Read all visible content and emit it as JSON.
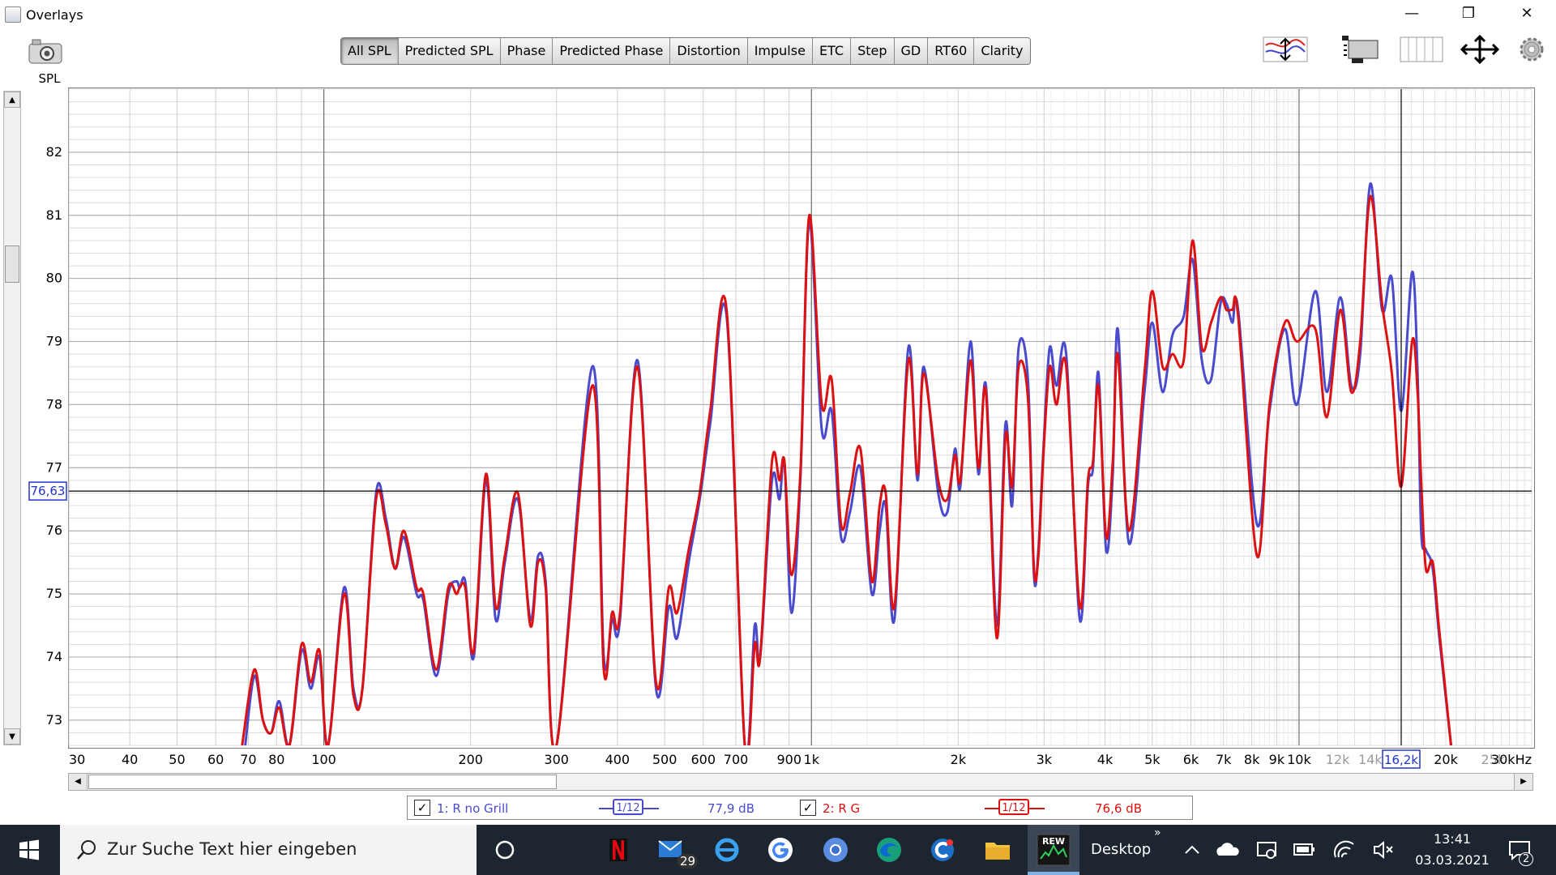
{
  "window": {
    "title": "Overlays",
    "min_glyph": "—",
    "max_glyph": "❐",
    "close_glyph": "✕"
  },
  "left_panel": {
    "label": "SPL"
  },
  "tabs": [
    {
      "label": "All SPL",
      "active": true
    },
    {
      "label": "Predicted SPL"
    },
    {
      "label": "Phase"
    },
    {
      "label": "Predicted Phase"
    },
    {
      "label": "Distortion"
    },
    {
      "label": "Impulse"
    },
    {
      "label": "ETC"
    },
    {
      "label": "Step"
    },
    {
      "label": "GD"
    },
    {
      "label": "RT60"
    },
    {
      "label": "Clarity"
    }
  ],
  "chart_data": {
    "type": "line",
    "x_scale": "log",
    "xlim": [
      30,
      30000
    ],
    "ylim": [
      72.6,
      83.0
    ],
    "grid": true,
    "y_ticks": [
      73,
      74,
      75,
      76,
      77,
      78,
      79,
      80,
      81,
      82
    ],
    "x_ticks": [
      {
        "v": 30,
        "l": "30"
      },
      {
        "v": 40,
        "l": "40"
      },
      {
        "v": 50,
        "l": "50"
      },
      {
        "v": 60,
        "l": "60"
      },
      {
        "v": 70,
        "l": "70"
      },
      {
        "v": 80,
        "l": "80"
      },
      {
        "v": 100,
        "l": "100"
      },
      {
        "v": 200,
        "l": "200"
      },
      {
        "v": 300,
        "l": "300"
      },
      {
        "v": 400,
        "l": "400"
      },
      {
        "v": 500,
        "l": "500"
      },
      {
        "v": 600,
        "l": "600"
      },
      {
        "v": 700,
        "l": "700"
      },
      {
        "v": 900,
        "l": "900"
      },
      {
        "v": 1000,
        "l": "1k"
      },
      {
        "v": 2000,
        "l": "2k"
      },
      {
        "v": 3000,
        "l": "3k"
      },
      {
        "v": 4000,
        "l": "4k"
      },
      {
        "v": 5000,
        "l": "5k"
      },
      {
        "v": 6000,
        "l": "6k"
      },
      {
        "v": 7000,
        "l": "7k"
      },
      {
        "v": 8000,
        "l": "8k"
      },
      {
        "v": 9000,
        "l": "9k"
      },
      {
        "v": 10000,
        "l": "10k"
      },
      {
        "v": 12000,
        "l": "12k",
        "faint": true
      },
      {
        "v": 14000,
        "l": "14k",
        "faint": true
      },
      {
        "v": 20000,
        "l": "20k"
      },
      {
        "v": 25000,
        "l": "25k",
        "faint": true
      },
      {
        "v": 30000,
        "l": "30kHz"
      }
    ],
    "cursor": {
      "x": 16200,
      "y": 76.63,
      "x_label": "16,2k",
      "y_label": "76,63"
    },
    "series": [
      {
        "name": "1: R no Grill",
        "color": "#4a4acc",
        "points": [
          [
            69,
            72.6
          ],
          [
            72,
            73.7
          ],
          [
            75,
            73.0
          ],
          [
            78,
            72.8
          ],
          [
            81,
            73.3
          ],
          [
            85,
            72.6
          ],
          [
            90,
            74.1
          ],
          [
            94,
            73.5
          ],
          [
            98,
            74.0
          ],
          [
            102,
            72.6
          ],
          [
            110,
            75.1
          ],
          [
            115,
            73.5
          ],
          [
            120,
            73.5
          ],
          [
            128,
            76.6
          ],
          [
            134,
            76.2
          ],
          [
            140,
            75.4
          ],
          [
            146,
            75.9
          ],
          [
            155,
            75.0
          ],
          [
            160,
            74.9
          ],
          [
            170,
            73.7
          ],
          [
            180,
            75.0
          ],
          [
            187,
            75.2
          ],
          [
            190,
            75.1
          ],
          [
            195,
            75.2
          ],
          [
            203,
            74.0
          ],
          [
            215,
            76.8
          ],
          [
            225,
            74.6
          ],
          [
            235,
            75.5
          ],
          [
            250,
            76.5
          ],
          [
            265,
            74.6
          ],
          [
            275,
            75.6
          ],
          [
            285,
            75.2
          ],
          [
            300,
            72.6
          ],
          [
            355,
            78.6
          ],
          [
            375,
            74.0
          ],
          [
            390,
            74.6
          ],
          [
            405,
            74.6
          ],
          [
            440,
            78.7
          ],
          [
            480,
            73.5
          ],
          [
            510,
            74.8
          ],
          [
            530,
            74.3
          ],
          [
            560,
            75.5
          ],
          [
            590,
            76.5
          ],
          [
            620,
            77.7
          ],
          [
            670,
            79.4
          ],
          [
            730,
            72.6
          ],
          [
            765,
            74.5
          ],
          [
            785,
            74.0
          ],
          [
            830,
            76.8
          ],
          [
            860,
            76.5
          ],
          [
            880,
            77.1
          ],
          [
            910,
            74.7
          ],
          [
            950,
            76.9
          ],
          [
            990,
            80.9
          ],
          [
            1050,
            77.6
          ],
          [
            1100,
            77.9
          ],
          [
            1150,
            75.9
          ],
          [
            1200,
            76.3
          ],
          [
            1260,
            77.0
          ],
          [
            1330,
            75.0
          ],
          [
            1380,
            76.0
          ],
          [
            1420,
            76.4
          ],
          [
            1480,
            74.6
          ],
          [
            1580,
            78.9
          ],
          [
            1650,
            76.8
          ],
          [
            1700,
            78.6
          ],
          [
            1820,
            76.6
          ],
          [
            1900,
            76.3
          ],
          [
            1970,
            77.3
          ],
          [
            2020,
            76.7
          ],
          [
            2120,
            79.0
          ],
          [
            2200,
            76.9
          ],
          [
            2280,
            78.3
          ],
          [
            2400,
            74.5
          ],
          [
            2500,
            77.7
          ],
          [
            2580,
            76.4
          ],
          [
            2660,
            78.9
          ],
          [
            2780,
            78.4
          ],
          [
            2860,
            75.3
          ],
          [
            2920,
            75.7
          ],
          [
            2990,
            77.3
          ],
          [
            3080,
            78.9
          ],
          [
            3180,
            78.3
          ],
          [
            3330,
            78.8
          ],
          [
            3550,
            74.6
          ],
          [
            3690,
            76.7
          ],
          [
            3780,
            77.0
          ],
          [
            3880,
            78.5
          ],
          [
            4020,
            75.7
          ],
          [
            4150,
            76.9
          ],
          [
            4250,
            79.2
          ],
          [
            4480,
            75.8
          ],
          [
            4820,
            78.2
          ],
          [
            5000,
            79.3
          ],
          [
            5250,
            78.2
          ],
          [
            5500,
            79.1
          ],
          [
            5800,
            79.4
          ],
          [
            6050,
            80.3
          ],
          [
            6320,
            78.7
          ],
          [
            6600,
            78.4
          ],
          [
            6900,
            79.6
          ],
          [
            7100,
            79.6
          ],
          [
            7300,
            79.3
          ],
          [
            7500,
            79.5
          ],
          [
            8200,
            76.1
          ],
          [
            8700,
            77.9
          ],
          [
            9350,
            79.2
          ],
          [
            9900,
            78.0
          ],
          [
            10800,
            79.8
          ],
          [
            11400,
            78.2
          ],
          [
            12150,
            79.7
          ],
          [
            12800,
            78.3
          ],
          [
            13350,
            78.8
          ],
          [
            14000,
            81.5
          ],
          [
            14800,
            79.5
          ],
          [
            15500,
            80.0
          ],
          [
            16200,
            77.9
          ],
          [
            17050,
            80.1
          ],
          [
            17500,
            78.5
          ],
          [
            17800,
            76.0
          ],
          [
            18200,
            75.7
          ],
          [
            18800,
            75.4
          ],
          [
            19400,
            74.3
          ],
          [
            20500,
            72.6
          ]
        ]
      },
      {
        "name": "2: R G",
        "color": "#dd1111",
        "points": [
          [
            68,
            72.6
          ],
          [
            72,
            73.8
          ],
          [
            75,
            73.0
          ],
          [
            78,
            72.8
          ],
          [
            81,
            73.2
          ],
          [
            85,
            72.6
          ],
          [
            90,
            74.2
          ],
          [
            94,
            73.6
          ],
          [
            98,
            74.1
          ],
          [
            102,
            72.6
          ],
          [
            110,
            75.0
          ],
          [
            115,
            73.4
          ],
          [
            120,
            73.5
          ],
          [
            128,
            76.5
          ],
          [
            134,
            76.1
          ],
          [
            140,
            75.4
          ],
          [
            146,
            76.0
          ],
          [
            155,
            75.1
          ],
          [
            160,
            75.0
          ],
          [
            170,
            73.8
          ],
          [
            180,
            75.1
          ],
          [
            187,
            75.0
          ],
          [
            190,
            75.1
          ],
          [
            195,
            75.1
          ],
          [
            203,
            74.1
          ],
          [
            215,
            76.9
          ],
          [
            225,
            74.8
          ],
          [
            235,
            75.6
          ],
          [
            250,
            76.6
          ],
          [
            265,
            74.5
          ],
          [
            275,
            75.5
          ],
          [
            285,
            75.1
          ],
          [
            300,
            72.6
          ],
          [
            355,
            78.3
          ],
          [
            375,
            73.8
          ],
          [
            390,
            74.7
          ],
          [
            405,
            74.7
          ],
          [
            440,
            78.6
          ],
          [
            480,
            73.6
          ],
          [
            510,
            75.1
          ],
          [
            530,
            74.7
          ],
          [
            560,
            75.7
          ],
          [
            590,
            76.6
          ],
          [
            620,
            77.9
          ],
          [
            670,
            79.5
          ],
          [
            730,
            72.6
          ],
          [
            765,
            74.2
          ],
          [
            785,
            74.0
          ],
          [
            830,
            77.1
          ],
          [
            860,
            76.8
          ],
          [
            880,
            77.1
          ],
          [
            910,
            75.3
          ],
          [
            950,
            77.0
          ],
          [
            990,
            81.0
          ],
          [
            1050,
            78.0
          ],
          [
            1100,
            78.4
          ],
          [
            1150,
            76.1
          ],
          [
            1200,
            76.6
          ],
          [
            1260,
            77.3
          ],
          [
            1330,
            75.2
          ],
          [
            1380,
            76.4
          ],
          [
            1420,
            76.6
          ],
          [
            1480,
            74.8
          ],
          [
            1580,
            78.7
          ],
          [
            1650,
            76.9
          ],
          [
            1700,
            78.5
          ],
          [
            1820,
            76.8
          ],
          [
            1900,
            76.5
          ],
          [
            1970,
            77.2
          ],
          [
            2020,
            76.8
          ],
          [
            2120,
            78.7
          ],
          [
            2200,
            77.0
          ],
          [
            2280,
            78.2
          ],
          [
            2400,
            74.3
          ],
          [
            2500,
            77.5
          ],
          [
            2580,
            76.7
          ],
          [
            2660,
            78.6
          ],
          [
            2780,
            78.1
          ],
          [
            2860,
            75.4
          ],
          [
            2920,
            75.6
          ],
          [
            2990,
            77.2
          ],
          [
            3080,
            78.6
          ],
          [
            3180,
            78.0
          ],
          [
            3330,
            78.6
          ],
          [
            3550,
            74.8
          ],
          [
            3690,
            76.8
          ],
          [
            3780,
            77.1
          ],
          [
            3880,
            78.3
          ],
          [
            4020,
            75.9
          ],
          [
            4150,
            77.1
          ],
          [
            4250,
            78.8
          ],
          [
            4480,
            76.0
          ],
          [
            4820,
            78.5
          ],
          [
            5000,
            79.8
          ],
          [
            5250,
            78.6
          ],
          [
            5500,
            78.8
          ],
          [
            5800,
            78.7
          ],
          [
            6050,
            80.6
          ],
          [
            6320,
            78.9
          ],
          [
            6600,
            79.3
          ],
          [
            6900,
            79.7
          ],
          [
            7100,
            79.5
          ],
          [
            7300,
            79.5
          ],
          [
            7500,
            79.4
          ],
          [
            8200,
            75.6
          ],
          [
            8700,
            78.0
          ],
          [
            9350,
            79.3
          ],
          [
            9900,
            79.0
          ],
          [
            10800,
            79.2
          ],
          [
            11400,
            77.8
          ],
          [
            12150,
            79.5
          ],
          [
            12800,
            78.2
          ],
          [
            13350,
            79.0
          ],
          [
            14000,
            81.3
          ],
          [
            14800,
            79.6
          ],
          [
            15500,
            78.5
          ],
          [
            16200,
            76.7
          ],
          [
            17050,
            79.0
          ],
          [
            17500,
            78.2
          ],
          [
            17800,
            76.8
          ],
          [
            18200,
            75.4
          ],
          [
            18800,
            75.5
          ],
          [
            19400,
            74.4
          ],
          [
            20500,
            72.6
          ]
        ]
      }
    ]
  },
  "legend": {
    "items": [
      {
        "check": "✓",
        "name": "1: R no Grill",
        "smoothing": "1/12",
        "value": "77,9 dB",
        "color": "#4a4acc"
      },
      {
        "check": "✓",
        "name": "2: R G",
        "smoothing": "1/12",
        "value": "76,6 dB",
        "color": "#dd1111"
      }
    ]
  },
  "taskbar": {
    "search_placeholder": "Zur Suche Text hier eingeben",
    "mail_badge": "29",
    "desktop_label": "Desktop",
    "time": "13:41",
    "date": "03.03.2021",
    "notification_badge": "2",
    "chevron": "»"
  }
}
